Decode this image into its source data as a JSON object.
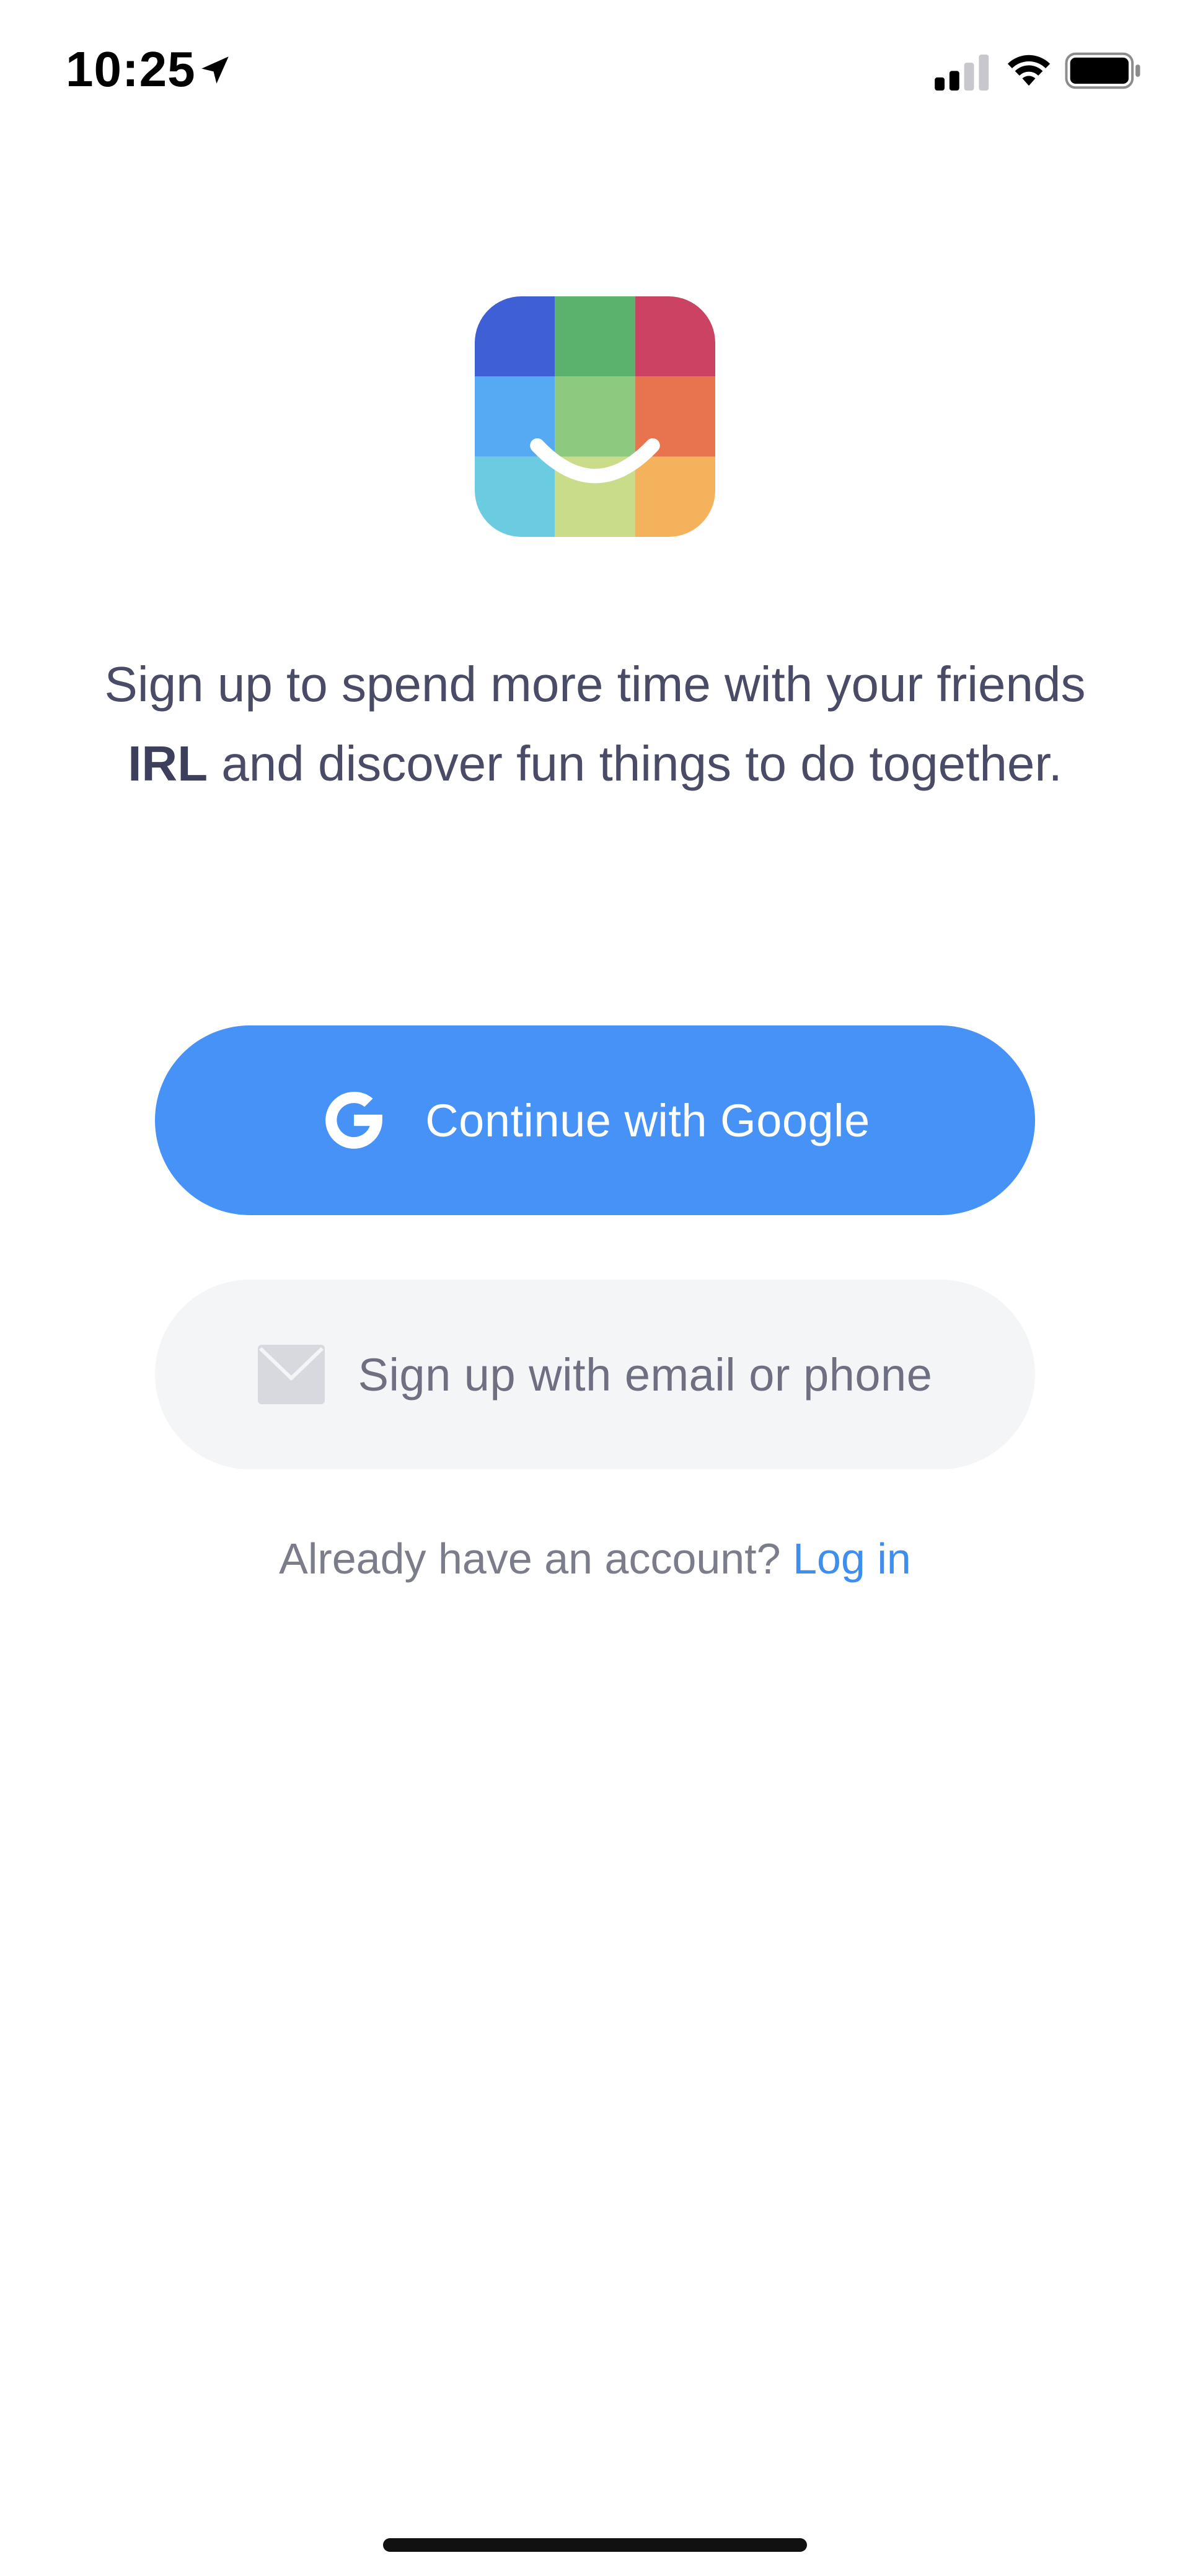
{
  "status_bar": {
    "time": "10:25",
    "icons": [
      "location-arrow-icon",
      "cellular-signal-icon",
      "wifi-icon",
      "battery-icon"
    ]
  },
  "logo": {
    "icon": "smiling-grid-logo",
    "colors": [
      "#3f5fd6",
      "#5ab26d",
      "#cc4262",
      "#56aaf3",
      "#8dc97f",
      "#e8744f",
      "#6bcbe0",
      "#c8dc8a",
      "#f4b25c"
    ]
  },
  "tagline": {
    "before": "Sign up to spend more time with your friends ",
    "bold": "IRL",
    "after": " and discover fun things to do together."
  },
  "buttons": {
    "google": {
      "label": "Continue with Google",
      "icon": "google-g-icon",
      "color": "#4792f7"
    },
    "email": {
      "label": "Sign up with email or phone",
      "icon": "envelope-icon",
      "color": "#f4f5f7"
    }
  },
  "login": {
    "prompt": "Already have an account?",
    "link_label": "Log in",
    "link_color": "#3e8ef0"
  }
}
